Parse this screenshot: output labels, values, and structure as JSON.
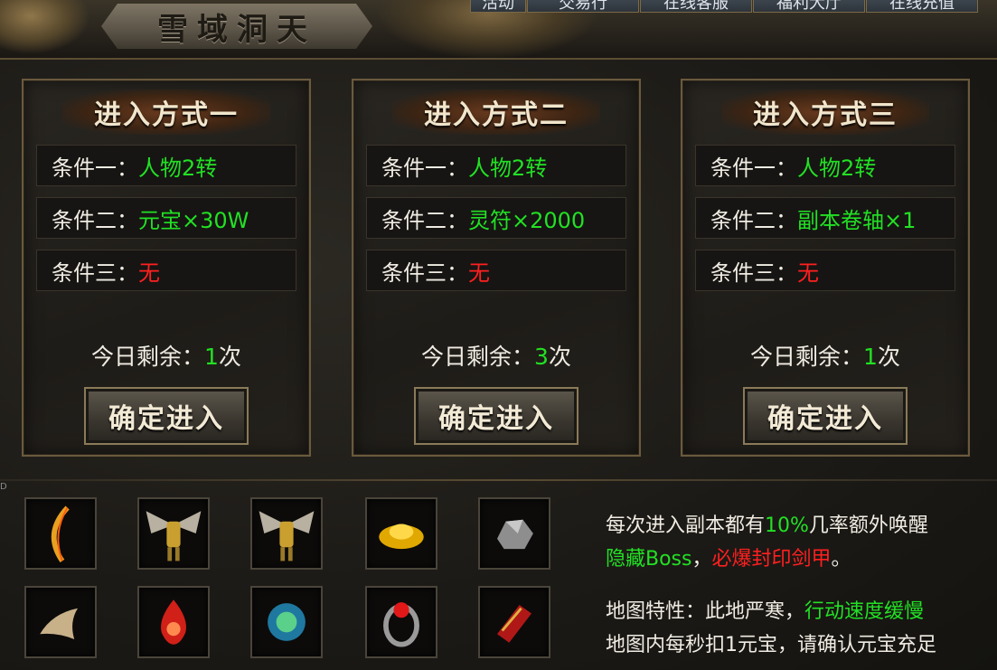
{
  "header": {
    "title": "雪域洞天",
    "tabs": [
      "活动",
      "交易行",
      "在线客服",
      "福利大厅",
      "在线充值"
    ]
  },
  "panels": [
    {
      "title": "进入方式一",
      "conditions": [
        {
          "label": "条件一：",
          "value": "人物2转",
          "color": "green"
        },
        {
          "label": "条件二：",
          "value": "元宝×30W",
          "color": "green"
        },
        {
          "label": "条件三：",
          "value": "无",
          "color": "red"
        }
      ],
      "remain_label": "今日剩余：",
      "remain_count": "1",
      "remain_unit": "次",
      "button": "确定进入"
    },
    {
      "title": "进入方式二",
      "conditions": [
        {
          "label": "条件一：",
          "value": "人物2转",
          "color": "green"
        },
        {
          "label": "条件二：",
          "value": "灵符×2000",
          "color": "green"
        },
        {
          "label": "条件三：",
          "value": "无",
          "color": "red"
        }
      ],
      "remain_label": "今日剩余：",
      "remain_count": "3",
      "remain_unit": "次",
      "button": "确定进入"
    },
    {
      "title": "进入方式三",
      "conditions": [
        {
          "label": "条件一：",
          "value": "人物2转",
          "color": "green"
        },
        {
          "label": "条件二：",
          "value": "副本卷轴×1",
          "color": "green"
        },
        {
          "label": "条件三：",
          "value": "无",
          "color": "red"
        }
      ],
      "remain_label": "今日剩余：",
      "remain_count": "1",
      "remain_unit": "次",
      "button": "确定进入"
    }
  ],
  "corner_label": "D",
  "items": [
    "bow-icon",
    "winged-armor-icon",
    "winged-armor-icon",
    "gold-ingot-icon",
    "ore-icon",
    "horn-icon",
    "flame-gem-icon",
    "orb-icon",
    "ruby-ring-icon",
    "red-bracer-icon"
  ],
  "info": {
    "line1": {
      "a": "每次进入副本都有",
      "b": "10%",
      "c": "几率额外唤醒"
    },
    "line2": {
      "a": "隐藏Boss",
      "b": "，",
      "c": "必爆封印剑甲",
      "d": "。"
    },
    "line3": {
      "a": "地图特性：此地严寒，",
      "b": "行动速度缓慢"
    },
    "line4": "地图内每秒扣1元宝，请确认元宝充足"
  },
  "colors": {
    "green": "#22e024",
    "red": "#ff2020",
    "text": "#f0ece3",
    "border": "#6a5a3d"
  }
}
